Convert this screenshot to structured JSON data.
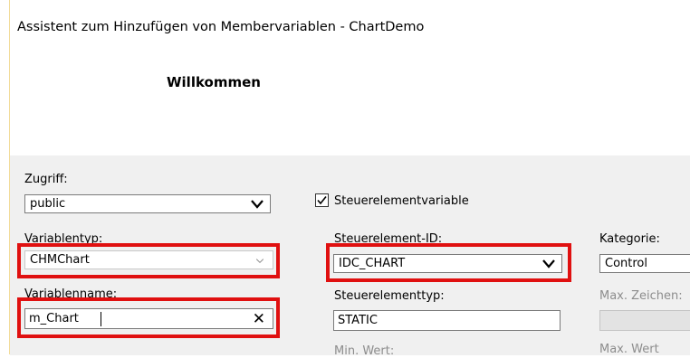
{
  "window": {
    "title": "Assistent zum Hinzufügen von Membervariablen - ChartDemo",
    "welcome": "Willkommen"
  },
  "access": {
    "label": "Zugriff:",
    "label_underline_char": "f",
    "value": "public"
  },
  "control_variable": {
    "label": "Steuerelementvariable",
    "checked": true
  },
  "variable_type": {
    "label": "Variablentyp:",
    "value": "CHMChart"
  },
  "control_id": {
    "label": "Steuerelement-ID:",
    "value": "IDC_CHART"
  },
  "category": {
    "label": "Kategorie:",
    "value": "Control"
  },
  "variable_name": {
    "label": "Variablenname:",
    "value": "m_Chart"
  },
  "control_type": {
    "label": "Steuerelementtyp:",
    "value": "STATIC"
  },
  "max_chars": {
    "label": "Max. Zeichen:",
    "value": ""
  },
  "min_value": {
    "label": "Min. Wert:"
  },
  "max_value": {
    "label": "Max. Wert"
  },
  "colors": {
    "highlight_border": "#e01010",
    "content_background": "#f0f0f0",
    "disabled_text": "#8d8d8d"
  }
}
